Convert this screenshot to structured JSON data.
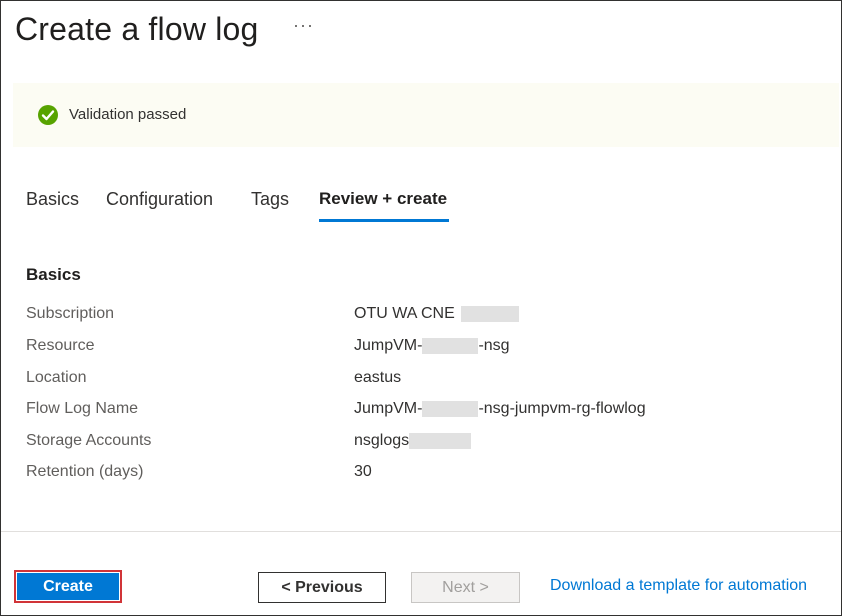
{
  "page": {
    "title": "Create a flow log",
    "more_menu": "···"
  },
  "banner": {
    "icon": "check-circle-icon",
    "text": "Validation passed",
    "color": "#57a300"
  },
  "tabs": [
    {
      "label": "Basics",
      "active": false
    },
    {
      "label": "Configuration",
      "active": false
    },
    {
      "label": "Tags",
      "active": false
    },
    {
      "label": "Review + create",
      "active": true
    }
  ],
  "section": {
    "title": "Basics",
    "rows": [
      {
        "label": "Subscription",
        "value": "OTU WA CNE",
        "value_suffix": ""
      },
      {
        "label": "Resource",
        "value": "JumpVM-",
        "value_suffix": "-nsg"
      },
      {
        "label": "Location",
        "value": "eastus",
        "value_suffix": ""
      },
      {
        "label": "Flow Log Name",
        "value": "JumpVM-",
        "value_suffix": "-nsg-jumpvm-rg-flowlog"
      },
      {
        "label": "Storage Accounts",
        "value": "nsglogs",
        "value_suffix": ""
      },
      {
        "label": "Retention (days)",
        "value": "30",
        "value_suffix": ""
      }
    ]
  },
  "footer": {
    "create_label": "Create",
    "previous_label": "< Previous",
    "next_label": "Next >",
    "download_link": "Download a template for automation"
  },
  "colors": {
    "accent": "#0078d4",
    "highlight_border": "#d13438",
    "banner_bg": "#fcfcf3"
  }
}
